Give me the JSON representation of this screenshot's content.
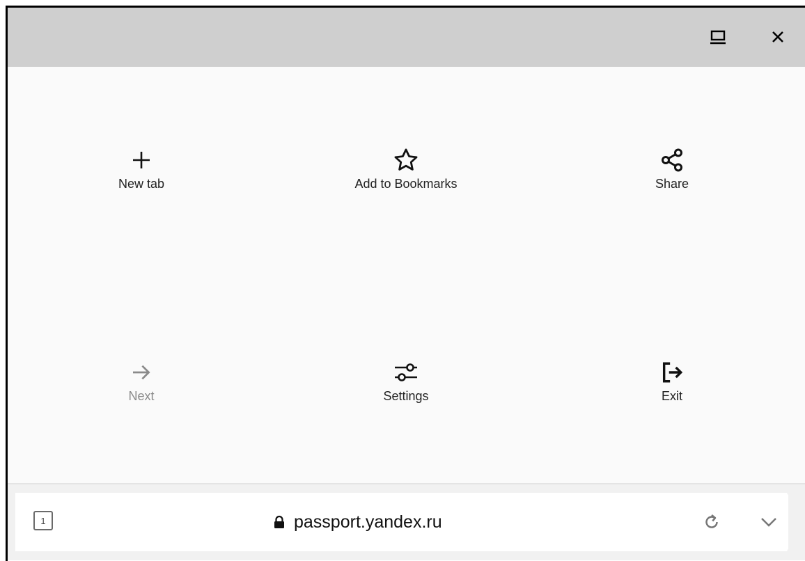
{
  "window": {
    "controls": [
      {
        "name": "minimize-window-icon"
      },
      {
        "name": "close-icon"
      }
    ]
  },
  "menu": {
    "items": [
      {
        "label": "New tab",
        "icon": "plus-icon",
        "enabled": true
      },
      {
        "label": "Add to Bookmarks",
        "icon": "star-icon",
        "enabled": true
      },
      {
        "label": "Share",
        "icon": "share-icon",
        "enabled": true
      },
      {
        "label": "Next",
        "icon": "arrow-right-icon",
        "enabled": false
      },
      {
        "label": "Settings",
        "icon": "settings-sliders-icon",
        "enabled": true
      },
      {
        "label": "Exit",
        "icon": "exit-icon",
        "enabled": true
      }
    ]
  },
  "address_bar": {
    "tab_count": "1",
    "url": "passport.yandex.ru",
    "secure_icon": "lock-icon",
    "reload_icon": "reload-icon",
    "expand_icon": "chevron-down-icon"
  },
  "colors": {
    "topbar": "#cfcfcf",
    "background": "#fafafa",
    "text": "#222222",
    "disabled_text": "#8a8a8a"
  }
}
